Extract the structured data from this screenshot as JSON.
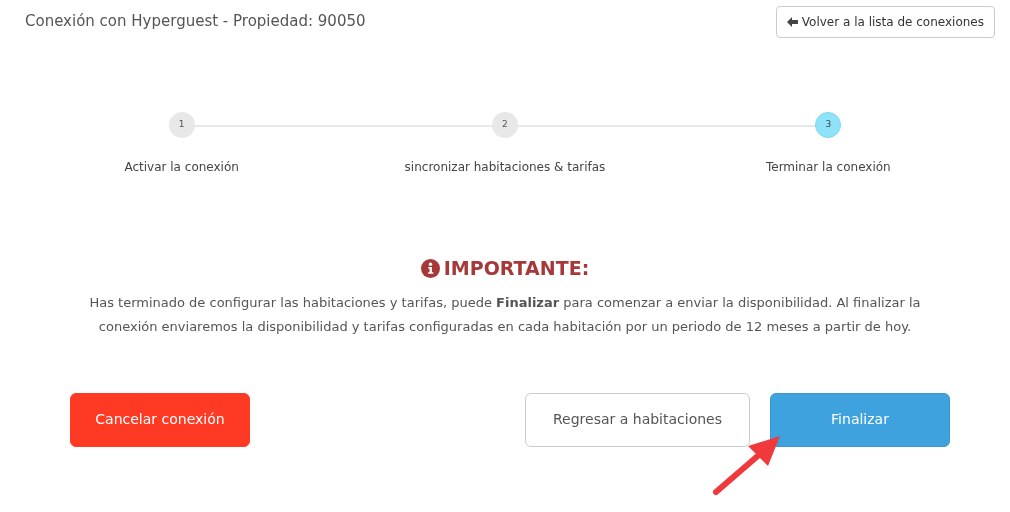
{
  "header": {
    "title": "Conexión con Hyperguest - Propiedad: 90050",
    "back_button": "Volver a la lista de conexiones"
  },
  "steps": [
    {
      "number": "1",
      "label": "Activar la conexión",
      "selected": false
    },
    {
      "number": "2",
      "label": "sincronizar habitaciones & tarifas",
      "selected": false
    },
    {
      "number": "3",
      "label": "Terminar la conexión",
      "selected": true
    }
  ],
  "notice": {
    "heading": "IMPORTANTE:",
    "text": "Has terminado de configurar las habitaciones y tarifas, puede **Finalizar** para comenzar a enviar la disponibilidad. Al finalizar la conexión enviaremos la disponibilidad y tarifas configuradas en cada habitación por un periodo de 12 meses a partir de hoy."
  },
  "buttons": [
    {
      "label": "Cancelar conexión",
      "kind": "danger"
    },
    {
      "label": "Regresar a habitaciones",
      "kind": "default"
    },
    {
      "label": "Finalizar",
      "kind": "primary"
    }
  ]
}
